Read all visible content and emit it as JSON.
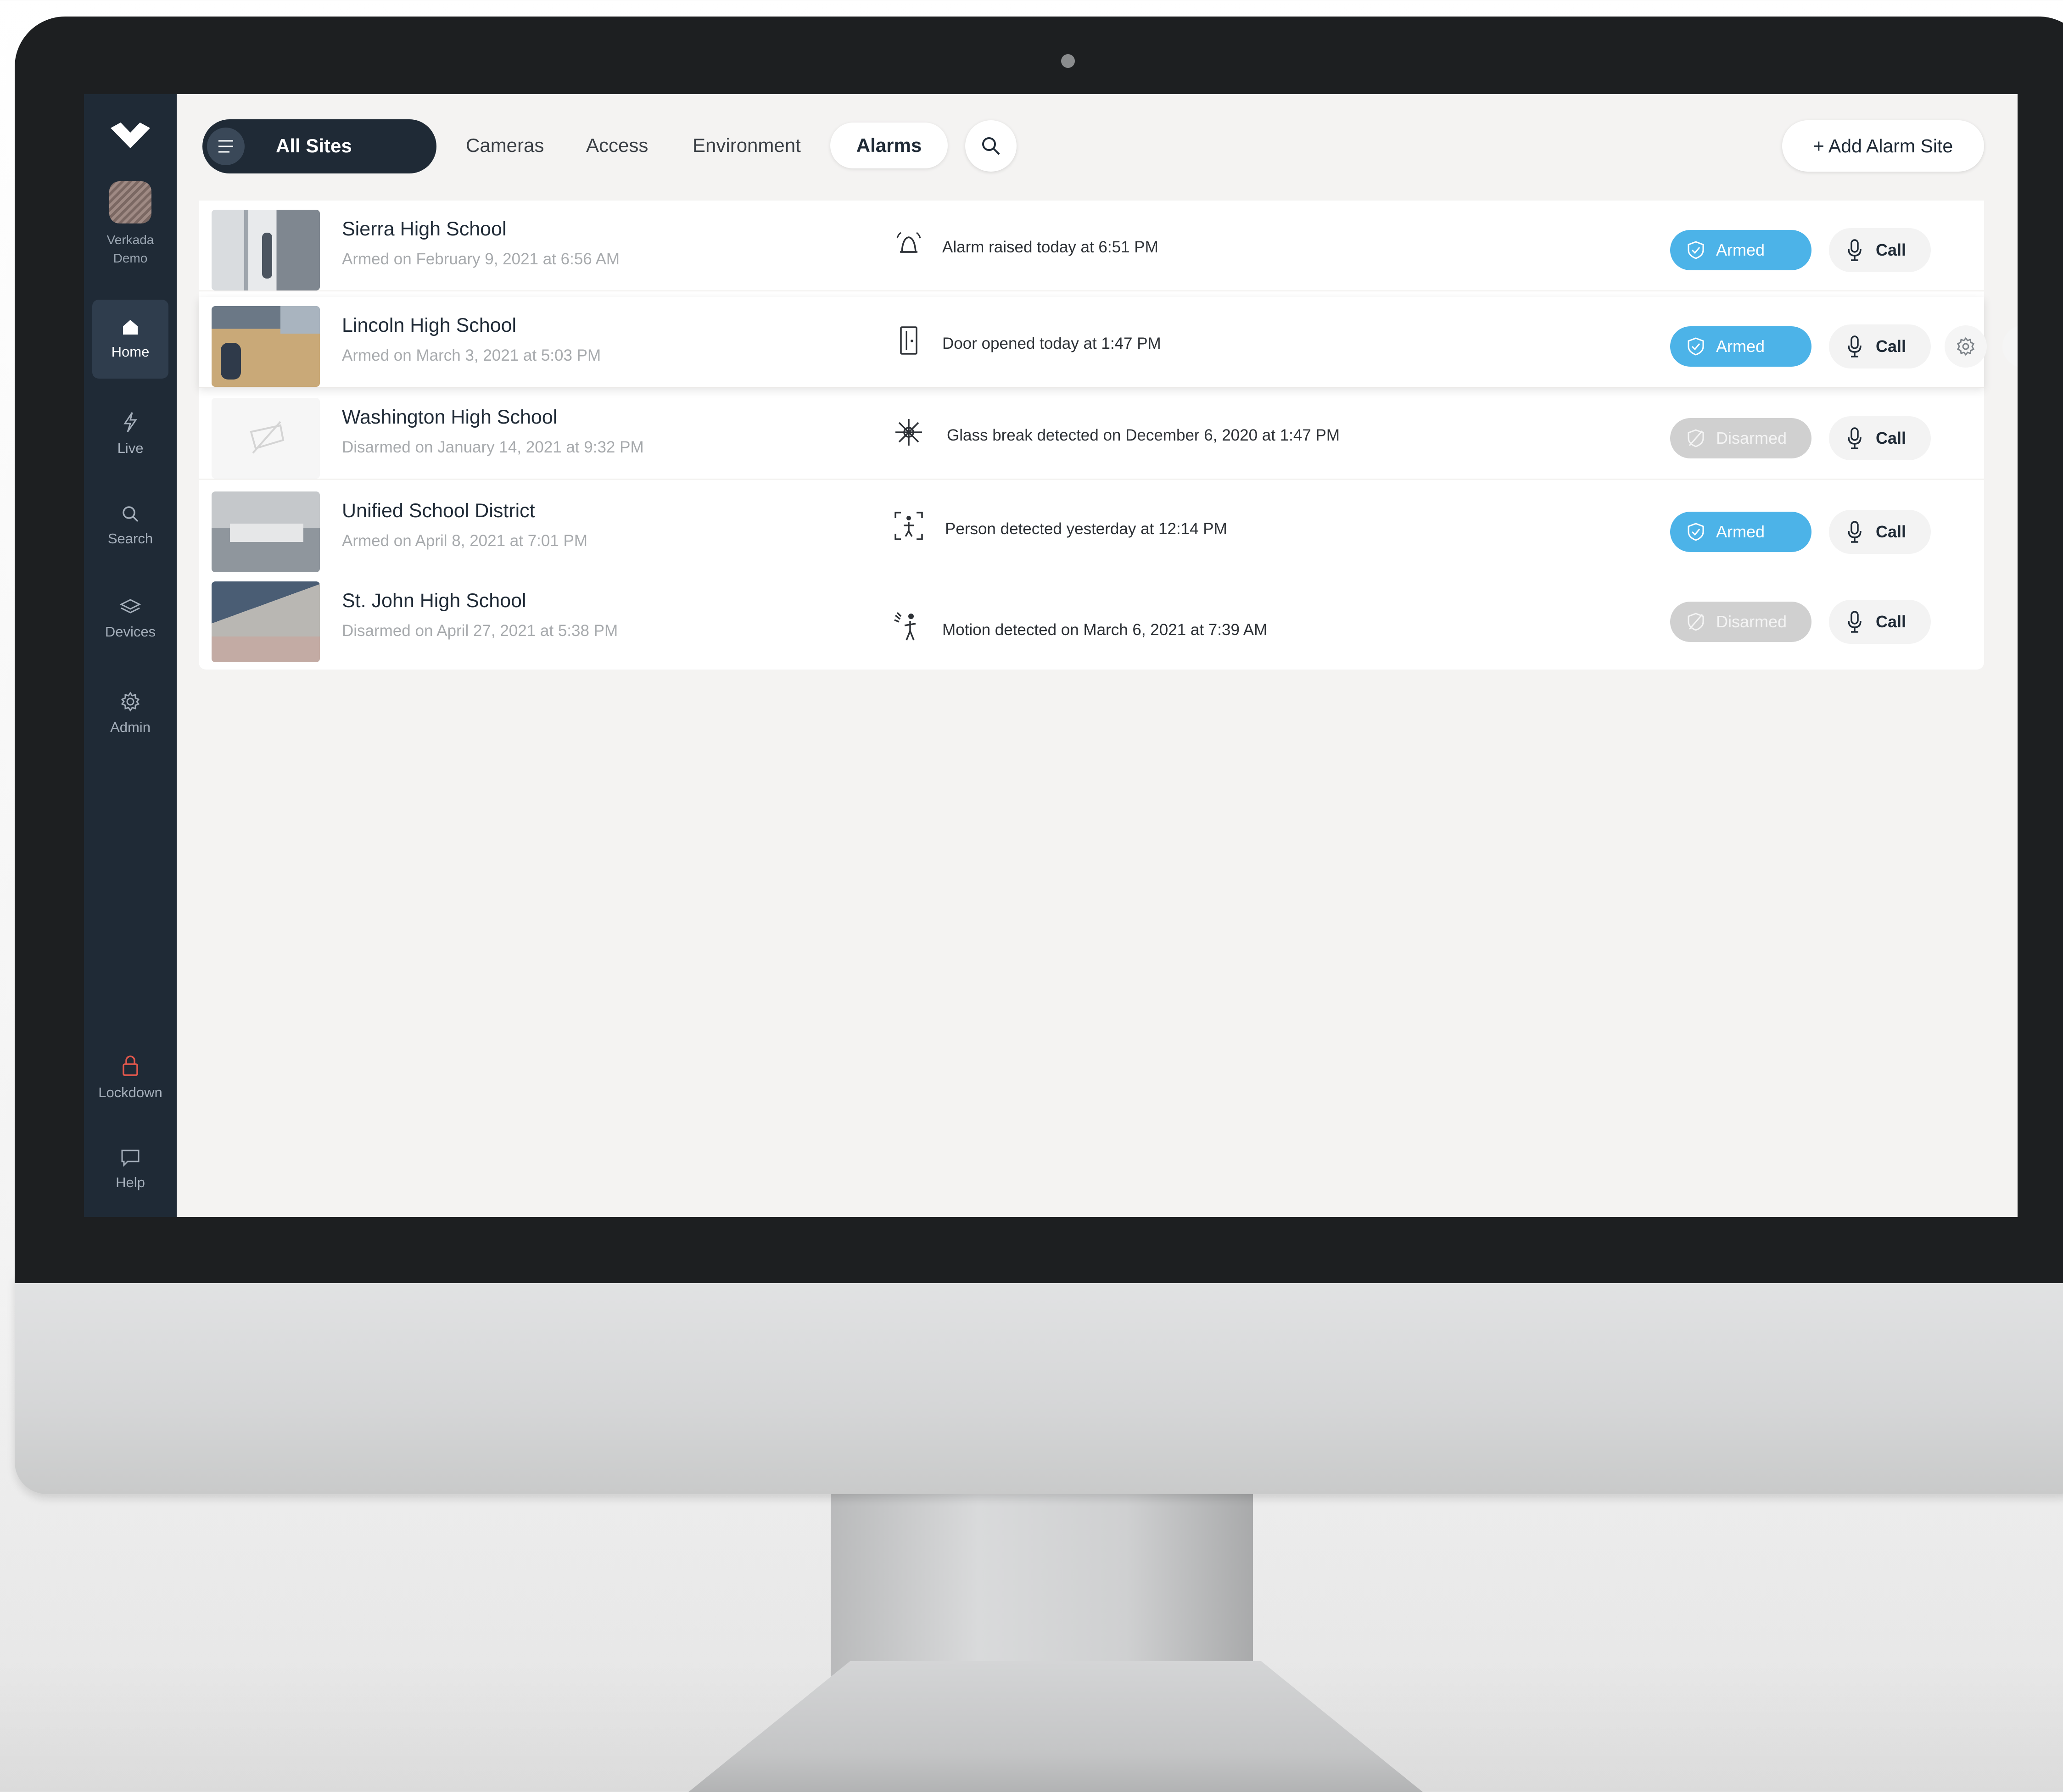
{
  "sidebar": {
    "org_name": "Verkada Demo",
    "items": [
      {
        "label": "Home",
        "icon": "home-icon",
        "active": true
      },
      {
        "label": "Live",
        "icon": "bolt-icon"
      },
      {
        "label": "Search",
        "icon": "search-icon"
      },
      {
        "label": "Devices",
        "icon": "devices-icon"
      },
      {
        "label": "Admin",
        "icon": "gear-icon"
      },
      {
        "label": "Lockdown",
        "icon": "lock-icon",
        "accent": "#e2574c"
      },
      {
        "label": "Help",
        "icon": "chat-icon"
      }
    ]
  },
  "topbar": {
    "site_selector": "All Sites",
    "tabs": [
      {
        "label": "Cameras"
      },
      {
        "label": "Access"
      },
      {
        "label": "Environment"
      },
      {
        "label": "Alarms",
        "active": true
      }
    ],
    "add_button": "+ Add Alarm Site"
  },
  "sites": [
    {
      "name": "Sierra High School",
      "subtitle": "Armed on February 9, 2021 at 6:56 AM",
      "event_icon": "alarm-bell-icon",
      "event": "Alarm raised today at 6:51 PM",
      "status": "Armed",
      "call": "Call"
    },
    {
      "name": "Lincoln High School",
      "subtitle": "Armed on March 3, 2021 at 5:03 PM",
      "event_icon": "door-icon",
      "event": "Door opened today at 1:47 PM",
      "status": "Armed",
      "call": "Call"
    },
    {
      "name": "Washington High School",
      "subtitle": "Disarmed on January 14, 2021 at 9:32 PM",
      "event_icon": "glass-break-icon",
      "event": "Glass break detected on December 6, 2020 at 1:47 PM",
      "status": "Disarmed",
      "call": "Call"
    },
    {
      "name": "Unified School District",
      "subtitle": "Armed on April 8, 2021 at 7:01 PM",
      "event_icon": "person-detect-icon",
      "event": "Person detected yesterday at 12:14 PM",
      "status": "Armed",
      "call": "Call"
    },
    {
      "name": "St. John High School",
      "subtitle": "Disarmed on April 27, 2021 at 5:38 PM",
      "event_icon": "motion-icon",
      "event": "Motion detected on March 6, 2021 at 7:39 AM",
      "status": "Disarmed",
      "call": "Call"
    }
  ],
  "colors": {
    "sidebar": "#1f2a36",
    "armed": "#4cb3e8",
    "disarmed": "#d0d0d0",
    "lockdown": "#e2574c"
  }
}
